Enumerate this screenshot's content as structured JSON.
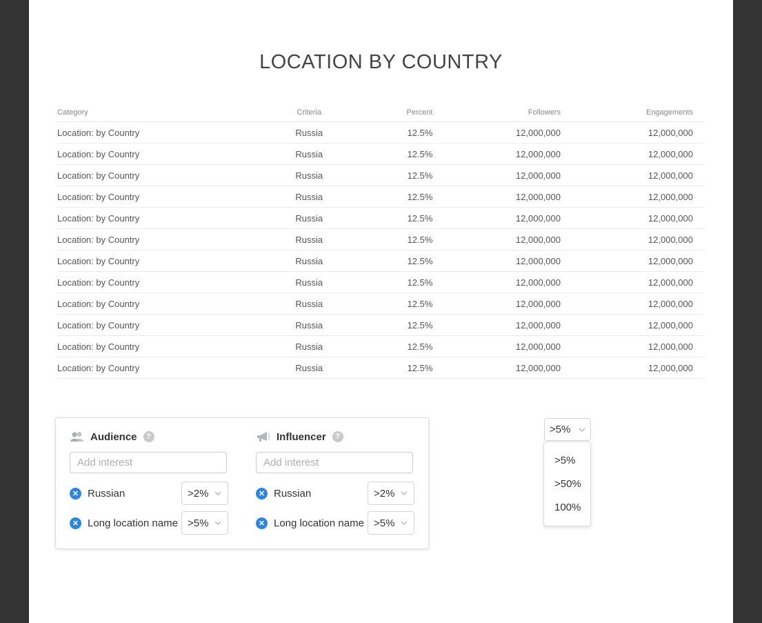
{
  "title": "LOCATION BY COUNTRY",
  "table": {
    "headers": [
      "Category",
      "Criteria",
      "Percent",
      "Followers",
      "Engagements"
    ],
    "rows": [
      [
        "Location: by Country",
        "Russia",
        "12.5%",
        "12,000,000",
        "12,000,000"
      ],
      [
        "Location: by Country",
        "Russia",
        "12.5%",
        "12,000,000",
        "12,000,000"
      ],
      [
        "Location: by Country",
        "Russia",
        "12.5%",
        "12,000,000",
        "12,000,000"
      ],
      [
        "Location: by Country",
        "Russia",
        "12.5%",
        "12,000,000",
        "12,000,000"
      ],
      [
        "Location: by Country",
        "Russia",
        "12.5%",
        "12,000,000",
        "12,000,000"
      ],
      [
        "Location: by Country",
        "Russia",
        "12.5%",
        "12,000,000",
        "12,000,000"
      ],
      [
        "Location: by Country",
        "Russia",
        "12.5%",
        "12,000,000",
        "12,000,000"
      ],
      [
        "Location: by Country",
        "Russia",
        "12.5%",
        "12,000,000",
        "12,000,000"
      ],
      [
        "Location: by Country",
        "Russia",
        "12.5%",
        "12,000,000",
        "12,000,000"
      ],
      [
        "Location: by Country",
        "Russia",
        "12.5%",
        "12,000,000",
        "12,000,000"
      ],
      [
        "Location: by Country",
        "Russia",
        "12.5%",
        "12,000,000",
        "12,000,000"
      ],
      [
        "Location: by Country",
        "Russia",
        "12.5%",
        "12,000,000",
        "12,000,000"
      ]
    ]
  },
  "filters": {
    "audience": {
      "title": "Audience",
      "icon": "audience-people-icon",
      "help": "?",
      "placeholder": "Add interest",
      "tags": [
        {
          "label": "Russian",
          "threshold": ">2%"
        },
        {
          "label": "Long location name",
          "threshold": ">5%"
        }
      ]
    },
    "influencer": {
      "title": "Influencer",
      "icon": "megaphone-icon",
      "help": "?",
      "placeholder": "Add interest",
      "tags": [
        {
          "label": "Russian",
          "threshold": ">2%"
        },
        {
          "label": "Long location name",
          "threshold": ">5%"
        }
      ]
    }
  },
  "threshold_dropdown": {
    "selected": ">5%",
    "options": [
      ">5%",
      ">50%",
      "100%"
    ]
  },
  "colors": {
    "accent": "#2a86e6",
    "backdrop": "#333333"
  }
}
